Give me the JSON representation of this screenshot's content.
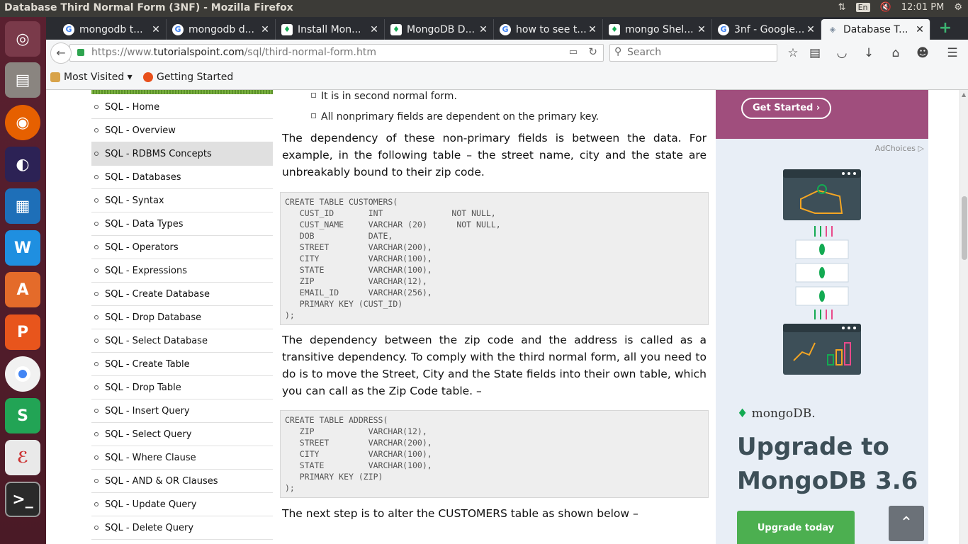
{
  "window": {
    "title": "Database Third Normal Form (3NF) - Mozilla Firefox"
  },
  "panel": {
    "keyboard": "En",
    "time": "12:01 PM"
  },
  "tabs": [
    {
      "label": "mongodb t...",
      "favicon": "google"
    },
    {
      "label": "mongodb d...",
      "favicon": "google"
    },
    {
      "label": "Install Mon...",
      "favicon": "mongodb"
    },
    {
      "label": "MongoDB D...",
      "favicon": "mongodb"
    },
    {
      "label": "how to see t...",
      "favicon": "google"
    },
    {
      "label": "mongo Shel...",
      "favicon": "mongodb"
    },
    {
      "label": "3nf - Google...",
      "favicon": "google"
    },
    {
      "label": "Database T...",
      "favicon": "diamond",
      "active": true
    }
  ],
  "url": {
    "prefix": "https://www.",
    "host": "tutorialspoint.com",
    "path": "/sql/third-normal-form.htm"
  },
  "search": {
    "placeholder": "Search"
  },
  "bookmarks": [
    {
      "label": "Most Visited ▾"
    },
    {
      "label": "Getting Started"
    }
  ],
  "sidenav": [
    "SQL - Home",
    "SQL - Overview",
    "SQL - RDBMS Concepts",
    "SQL - Databases",
    "SQL - Syntax",
    "SQL - Data Types",
    "SQL - Operators",
    "SQL - Expressions",
    "SQL - Create Database",
    "SQL - Drop Database",
    "SQL - Select Database",
    "SQL - Create Table",
    "SQL - Drop Table",
    "SQL - Insert Query",
    "SQL - Select Query",
    "SQL - Where Clause",
    "SQL - AND & OR Clauses",
    "SQL - Update Query",
    "SQL - Delete Query"
  ],
  "content": {
    "bullets": [
      "It is in second normal form.",
      "All nonprimary fields are dependent on the primary key."
    ],
    "para1": "The dependency of these non-primary fields is between the data. For example, in the following table – the street name, city and the state are unbreakably bound to their zip code.",
    "code1": "CREATE TABLE CUSTOMERS(\n   CUST_ID       INT              NOT NULL,\n   CUST_NAME     VARCHAR (20)      NOT NULL,\n   DOB           DATE,\n   STREET        VARCHAR(200),\n   CITY          VARCHAR(100),\n   STATE         VARCHAR(100),\n   ZIP           VARCHAR(12),\n   EMAIL_ID      VARCHAR(256),\n   PRIMARY KEY (CUST_ID)\n);",
    "para2": "The dependency between the zip code and the address is called as a transitive dependency. To comply with the third normal form, all you need to do is to move the Street, City and the State fields into their own table, which you can call as the Zip Code table. –",
    "code2": "CREATE TABLE ADDRESS(\n   ZIP           VARCHAR(12),\n   STREET        VARCHAR(200),\n   CITY          VARCHAR(100),\n   STATE         VARCHAR(100),\n   PRIMARY KEY (ZIP)\n);",
    "para3": "The next step is to alter the CUSTOMERS table as shown below –"
  },
  "ad": {
    "get_started": "Get Started ›",
    "adchoices": "AdChoices ▷",
    "brand": "mongoDB.",
    "headline": "Upgrade to MongoDB 3.6",
    "cta": "Upgrade today"
  }
}
